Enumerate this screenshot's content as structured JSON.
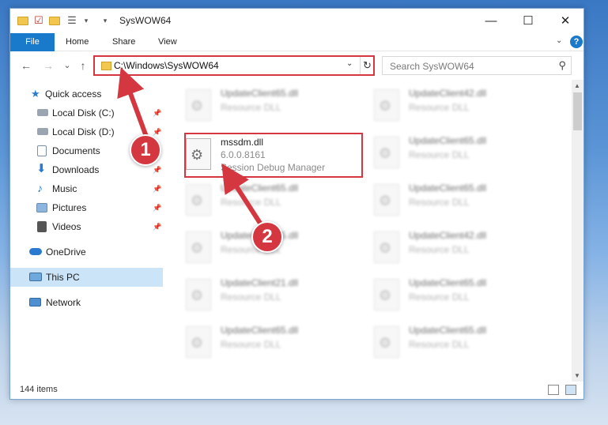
{
  "window": {
    "title": "SysWOW64",
    "controls": {
      "minimize": "—",
      "maximize": "☐",
      "close": "✕"
    }
  },
  "ribbon": {
    "tabs": [
      "File",
      "Home",
      "Share",
      "View"
    ],
    "help": "?"
  },
  "navigation": {
    "back": "←",
    "forward": "→",
    "recent": "⌄",
    "up": "↑",
    "address": "C:\\Windows\\SysWOW64",
    "address_dropdown": "⌄",
    "refresh": "↻",
    "search_placeholder": "Search SysWOW64",
    "search_icon": "⚲"
  },
  "sidebar": {
    "items": [
      {
        "label": "Quick access",
        "icon": "star-icon"
      },
      {
        "label": "Local Disk (C:)",
        "icon": "drive-icon",
        "pinned": true
      },
      {
        "label": "Local Disk (D:)",
        "icon": "drive-icon",
        "pinned": true
      },
      {
        "label": "Documents",
        "icon": "documents-icon",
        "pinned": true
      },
      {
        "label": "Downloads",
        "icon": "downloads-icon",
        "pinned": true
      },
      {
        "label": "Music",
        "icon": "music-icon",
        "pinned": true
      },
      {
        "label": "Pictures",
        "icon": "pictures-icon",
        "pinned": true
      },
      {
        "label": "Videos",
        "icon": "videos-icon",
        "pinned": true
      },
      {
        "label": "OneDrive",
        "icon": "cloud-icon"
      },
      {
        "label": "This PC",
        "icon": "computer-icon",
        "selected": true
      },
      {
        "label": "Network",
        "icon": "network-icon"
      }
    ]
  },
  "files": [
    {
      "name": "UpdateClient65.dll",
      "desc": "Resource DLL",
      "blurred": true
    },
    {
      "name": "UpdateClient42.dll",
      "desc": "Resource DLL",
      "blurred": true
    },
    {
      "name": "mssdm.dll",
      "desc": "6.0.0.8161",
      "type": "Session Debug Manager",
      "blurred": false
    },
    {
      "name": "UpdateClient65.dll",
      "desc": "Resource DLL",
      "blurred": true
    },
    {
      "name": "UpdateClient65.dll",
      "desc": "Resource DLL",
      "blurred": true
    },
    {
      "name": "UpdateClient65.dll",
      "desc": "Resource DLL",
      "blurred": true
    },
    {
      "name": "UpdateClient65.dll",
      "desc": "Resource DLL",
      "blurred": true
    },
    {
      "name": "UpdateClient42.dll",
      "desc": "Resource DLL",
      "blurred": true
    },
    {
      "name": "UpdateClient21.dll",
      "desc": "Resource DLL",
      "blurred": true
    },
    {
      "name": "UpdateClient65.dll",
      "desc": "Resource DLL",
      "blurred": true
    },
    {
      "name": "UpdateClient65.dll",
      "desc": "Resource DLL",
      "blurred": true
    },
    {
      "name": "UpdateClient65.dll",
      "desc": "Resource DLL",
      "blurred": true
    }
  ],
  "status": {
    "item_count": "144 items"
  },
  "callouts": [
    "1",
    "2"
  ],
  "colors": {
    "accent": "#1979ca",
    "highlight": "#d4373f",
    "selected": "#cce4f7"
  }
}
